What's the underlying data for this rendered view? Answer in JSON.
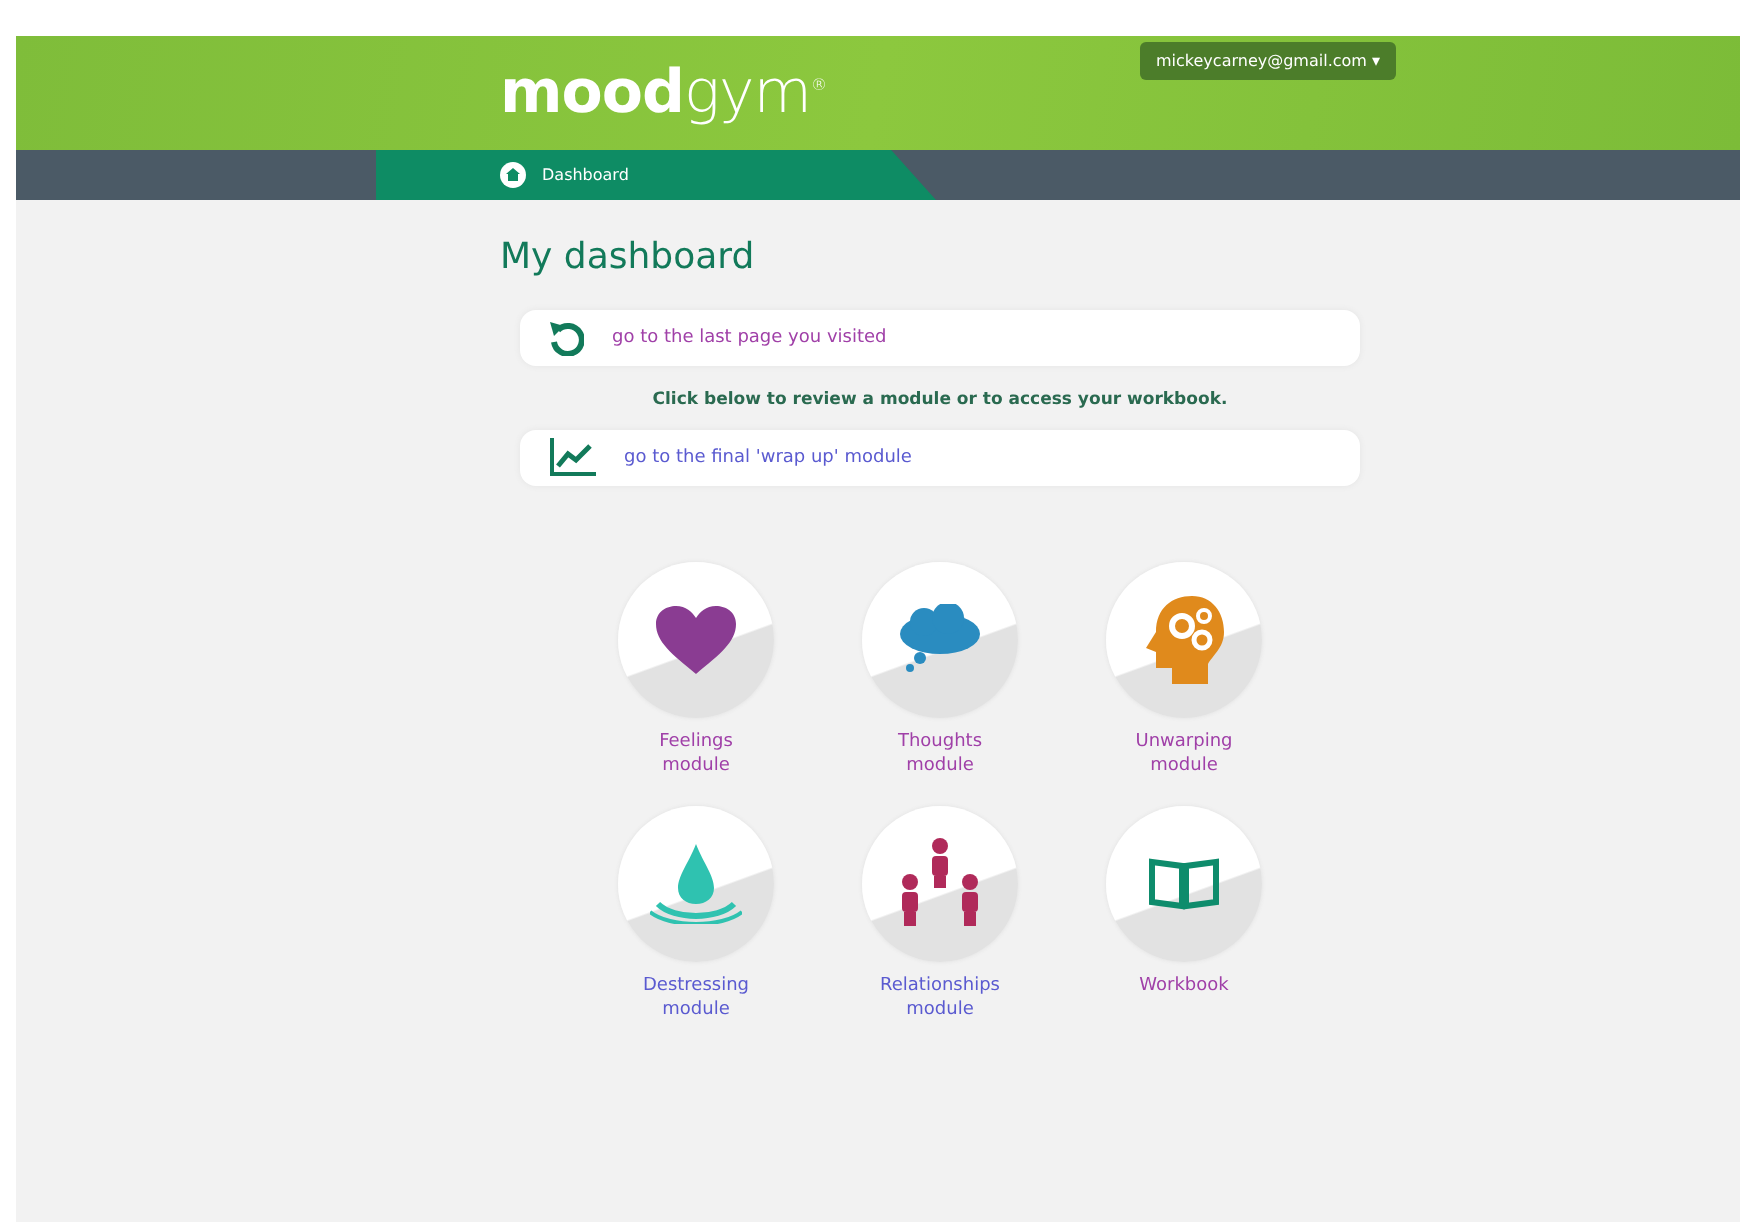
{
  "header": {
    "logo": "**mood**gym$^{®}$",
    "account": "mickeycarney@gmail.com",
    "account_caret": "▾"
  },
  "nav": {
    "tab": "Dashboard"
  },
  "title": "My dashboard",
  "links": [
    {
      "kind": "return",
      "label": "go to the last page you visited",
      "color": "#a040a8"
    },
    {
      "kind": "chart",
      "label": "go to the final 'wrap up' module",
      "color": "#5a5ad0"
    }
  ],
  "instruction": "Click below to review a module or to access your workbook.",
  "modules": [
    {
      "kind": "heart",
      "label": "Feelings module",
      "color": "#a040a8"
    },
    {
      "kind": "cloud",
      "label": "Thoughts module",
      "color": "#a040a8"
    },
    {
      "kind": "head",
      "label": "Unwarping module",
      "color": "#a040a8"
    },
    {
      "kind": "drop",
      "label": "Destressing module",
      "color": "#5a5ad0"
    },
    {
      "kind": "people",
      "label": "Relationships module",
      "color": "#5a5ad0"
    },
    {
      "kind": "book",
      "label": "Workbook",
      "color": "#a040a8"
    }
  ]
}
